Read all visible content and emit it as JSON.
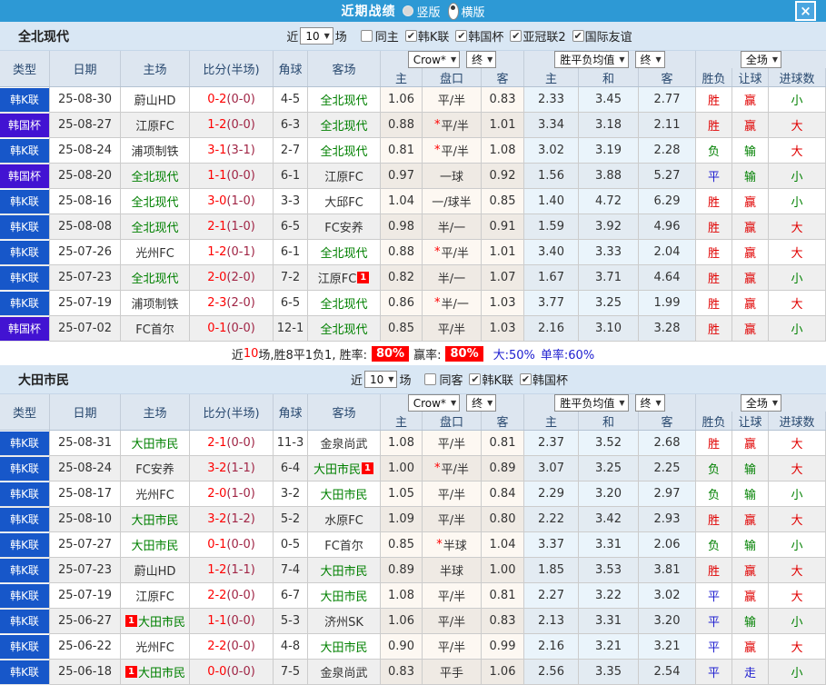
{
  "topbar": {
    "title": "近期战绩",
    "radios": [
      {
        "label": "竖版",
        "selected": false
      },
      {
        "label": "横版",
        "selected": true
      }
    ],
    "close": "×"
  },
  "filter_bar": {
    "near": "近",
    "count": "10",
    "games": "场"
  },
  "header": {
    "cols": {
      "type": "类型",
      "date": "日期",
      "home": "主场",
      "score": "比分(半场)",
      "corner": "角球",
      "away": "客场",
      "h": "主",
      "pan": "盘口",
      "a": "客",
      "avg_h": "主",
      "avg_d": "和",
      "avg_a": "客",
      "wl": "胜负",
      "hcp": "让球",
      "goals": "进球数"
    },
    "selects": {
      "bookmaker": "Crow*",
      "final1": "终",
      "avg": "胜平负均值",
      "final2": "终",
      "scope": "全场"
    }
  },
  "sections": [
    {
      "team": "全北现代",
      "filters": [
        {
          "label": "同主",
          "checked": false
        },
        {
          "label": "韩K联",
          "checked": true
        },
        {
          "label": "韩国杯",
          "checked": true
        },
        {
          "label": "亚冠联2",
          "checked": true
        },
        {
          "label": "国际友谊",
          "checked": true
        }
      ],
      "rows": [
        {
          "t": "韩K联",
          "tc": "lg",
          "d": "25-08-30",
          "h": "蔚山HD",
          "hg": 0,
          "hb": "",
          "hpre": false,
          "sf": "0-2",
          "sh": "(0-0)",
          "c": "4-5",
          "a": "全北现代",
          "ag": 1,
          "ab": "",
          "apre": false,
          "o1": "1.06",
          "ps": 0,
          "p": "平/半",
          "o2": "0.83",
          "m1": "2.33",
          "m2": "3.45",
          "m3": "2.77",
          "r1": "胜",
          "k1": "r",
          "r2": "赢",
          "k2": "r",
          "r3": "小",
          "k3": "g"
        },
        {
          "t": "韩国杯",
          "tc": "cup",
          "d": "25-08-27",
          "h": "江原FC",
          "hg": 0,
          "hb": "",
          "hpre": false,
          "sf": "1-2",
          "sh": "(0-0)",
          "c": "6-3",
          "a": "全北现代",
          "ag": 1,
          "ab": "",
          "apre": false,
          "o1": "0.88",
          "ps": 1,
          "p": "平/半",
          "o2": "1.01",
          "m1": "3.34",
          "m2": "3.18",
          "m3": "2.11",
          "r1": "胜",
          "k1": "r",
          "r2": "赢",
          "k2": "r",
          "r3": "大",
          "k3": "r"
        },
        {
          "t": "韩K联",
          "tc": "lg",
          "d": "25-08-24",
          "h": "浦项制铁",
          "hg": 0,
          "hb": "",
          "hpre": false,
          "sf": "3-1",
          "sh": "(3-1)",
          "c": "2-7",
          "a": "全北现代",
          "ag": 1,
          "ab": "",
          "apre": false,
          "o1": "0.81",
          "ps": 1,
          "p": "平/半",
          "o2": "1.08",
          "m1": "3.02",
          "m2": "3.19",
          "m3": "2.28",
          "r1": "负",
          "k1": "g",
          "r2": "输",
          "k2": "g",
          "r3": "大",
          "k3": "r"
        },
        {
          "t": "韩国杯",
          "tc": "cup",
          "d": "25-08-20",
          "h": "全北现代",
          "hg": 1,
          "hb": "",
          "hpre": false,
          "sf": "1-1",
          "sh": "(0-0)",
          "c": "6-1",
          "a": "江原FC",
          "ag": 0,
          "ab": "",
          "apre": false,
          "o1": "0.97",
          "ps": 0,
          "p": "一球",
          "o2": "0.92",
          "m1": "1.56",
          "m2": "3.88",
          "m3": "5.27",
          "r1": "平",
          "k1": "b",
          "r2": "输",
          "k2": "g",
          "r3": "小",
          "k3": "g"
        },
        {
          "t": "韩K联",
          "tc": "lg",
          "d": "25-08-16",
          "h": "全北现代",
          "hg": 1,
          "hb": "",
          "hpre": false,
          "sf": "3-0",
          "sh": "(1-0)",
          "c": "3-3",
          "a": "大邱FC",
          "ag": 0,
          "ab": "",
          "apre": false,
          "o1": "1.04",
          "ps": 0,
          "p": "一/球半",
          "o2": "0.85",
          "m1": "1.40",
          "m2": "4.72",
          "m3": "6.29",
          "r1": "胜",
          "k1": "r",
          "r2": "赢",
          "k2": "r",
          "r3": "小",
          "k3": "g"
        },
        {
          "t": "韩K联",
          "tc": "lg",
          "d": "25-08-08",
          "h": "全北现代",
          "hg": 1,
          "hb": "",
          "hpre": false,
          "sf": "2-1",
          "sh": "(1-0)",
          "c": "6-5",
          "a": "FC安养",
          "ag": 0,
          "ab": "",
          "apre": false,
          "o1": "0.98",
          "ps": 0,
          "p": "半/一",
          "o2": "0.91",
          "m1": "1.59",
          "m2": "3.92",
          "m3": "4.96",
          "r1": "胜",
          "k1": "r",
          "r2": "赢",
          "k2": "r",
          "r3": "大",
          "k3": "r"
        },
        {
          "t": "韩K联",
          "tc": "lg",
          "d": "25-07-26",
          "h": "光州FC",
          "hg": 0,
          "hb": "",
          "hpre": false,
          "sf": "1-2",
          "sh": "(0-1)",
          "c": "6-1",
          "a": "全北现代",
          "ag": 1,
          "ab": "",
          "apre": false,
          "o1": "0.88",
          "ps": 1,
          "p": "平/半",
          "o2": "1.01",
          "m1": "3.40",
          "m2": "3.33",
          "m3": "2.04",
          "r1": "胜",
          "k1": "r",
          "r2": "赢",
          "k2": "r",
          "r3": "大",
          "k3": "r"
        },
        {
          "t": "韩K联",
          "tc": "lg",
          "d": "25-07-23",
          "h": "全北现代",
          "hg": 1,
          "hb": "",
          "hpre": false,
          "sf": "2-0",
          "sh": "(2-0)",
          "c": "7-2",
          "a": "江原FC",
          "ag": 0,
          "ab": "1",
          "apre": false,
          "o1": "0.82",
          "ps": 0,
          "p": "半/一",
          "o2": "1.07",
          "m1": "1.67",
          "m2": "3.71",
          "m3": "4.64",
          "r1": "胜",
          "k1": "r",
          "r2": "赢",
          "k2": "r",
          "r3": "小",
          "k3": "g"
        },
        {
          "t": "韩K联",
          "tc": "lg",
          "d": "25-07-19",
          "h": "浦项制铁",
          "hg": 0,
          "hb": "",
          "hpre": false,
          "sf": "2-3",
          "sh": "(2-0)",
          "c": "6-5",
          "a": "全北现代",
          "ag": 1,
          "ab": "",
          "apre": false,
          "o1": "0.86",
          "ps": 1,
          "p": "半/一",
          "o2": "1.03",
          "m1": "3.77",
          "m2": "3.25",
          "m3": "1.99",
          "r1": "胜",
          "k1": "r",
          "r2": "赢",
          "k2": "r",
          "r3": "大",
          "k3": "r"
        },
        {
          "t": "韩国杯",
          "tc": "cup",
          "d": "25-07-02",
          "h": "FC首尔",
          "hg": 0,
          "hb": "",
          "hpre": false,
          "sf": "0-1",
          "sh": "(0-0)",
          "c": "12-1",
          "a": "全北现代",
          "ag": 1,
          "ab": "",
          "apre": false,
          "o1": "0.85",
          "ps": 0,
          "p": "平/半",
          "o2": "1.03",
          "m1": "2.16",
          "m2": "3.10",
          "m3": "3.28",
          "r1": "胜",
          "k1": "r",
          "r2": "赢",
          "k2": "r",
          "r3": "小",
          "k3": "g"
        }
      ],
      "summary": {
        "prefix": "近",
        "count": "10",
        "mid": "场,胜8平1负1, 胜率:",
        "rate1": "80%",
        "label2": "赢率:",
        "rate2": "80%",
        "big": "大:50%",
        "single": "单率:60%"
      }
    },
    {
      "team": "大田市民",
      "filters": [
        {
          "label": "同客",
          "checked": false
        },
        {
          "label": "韩K联",
          "checked": true
        },
        {
          "label": "韩国杯",
          "checked": true
        }
      ],
      "rows": [
        {
          "t": "韩K联",
          "tc": "lg",
          "d": "25-08-31",
          "h": "大田市民",
          "hg": 1,
          "hb": "",
          "hpre": false,
          "sf": "2-1",
          "sh": "(0-0)",
          "c": "11-3",
          "a": "金泉尚武",
          "ag": 0,
          "ab": "",
          "apre": false,
          "o1": "1.08",
          "ps": 0,
          "p": "平/半",
          "o2": "0.81",
          "m1": "2.37",
          "m2": "3.52",
          "m3": "2.68",
          "r1": "胜",
          "k1": "r",
          "r2": "赢",
          "k2": "r",
          "r3": "大",
          "k3": "r"
        },
        {
          "t": "韩K联",
          "tc": "lg",
          "d": "25-08-24",
          "h": "FC安养",
          "hg": 0,
          "hb": "",
          "hpre": false,
          "sf": "3-2",
          "sh": "(1-1)",
          "c": "6-4",
          "a": "大田市民",
          "ag": 1,
          "ab": "1",
          "apre": false,
          "o1": "1.00",
          "ps": 1,
          "p": "平/半",
          "o2": "0.89",
          "m1": "3.07",
          "m2": "3.25",
          "m3": "2.25",
          "r1": "负",
          "k1": "g",
          "r2": "输",
          "k2": "g",
          "r3": "大",
          "k3": "r"
        },
        {
          "t": "韩K联",
          "tc": "lg",
          "d": "25-08-17",
          "h": "光州FC",
          "hg": 0,
          "hb": "",
          "hpre": false,
          "sf": "2-0",
          "sh": "(1-0)",
          "c": "3-2",
          "a": "大田市民",
          "ag": 1,
          "ab": "",
          "apre": false,
          "o1": "1.05",
          "ps": 0,
          "p": "平/半",
          "o2": "0.84",
          "m1": "2.29",
          "m2": "3.20",
          "m3": "2.97",
          "r1": "负",
          "k1": "g",
          "r2": "输",
          "k2": "g",
          "r3": "小",
          "k3": "g"
        },
        {
          "t": "韩K联",
          "tc": "lg",
          "d": "25-08-10",
          "h": "大田市民",
          "hg": 1,
          "hb": "",
          "hpre": false,
          "sf": "3-2",
          "sh": "(1-2)",
          "c": "5-2",
          "a": "水原FC",
          "ag": 0,
          "ab": "",
          "apre": false,
          "o1": "1.09",
          "ps": 0,
          "p": "平/半",
          "o2": "0.80",
          "m1": "2.22",
          "m2": "3.42",
          "m3": "2.93",
          "r1": "胜",
          "k1": "r",
          "r2": "赢",
          "k2": "r",
          "r3": "大",
          "k3": "r"
        },
        {
          "t": "韩K联",
          "tc": "lg",
          "d": "25-07-27",
          "h": "大田市民",
          "hg": 1,
          "hb": "",
          "hpre": false,
          "sf": "0-1",
          "sh": "(0-0)",
          "c": "0-5",
          "a": "FC首尔",
          "ag": 0,
          "ab": "",
          "apre": false,
          "o1": "0.85",
          "ps": 1,
          "p": "半球",
          "o2": "1.04",
          "m1": "3.37",
          "m2": "3.31",
          "m3": "2.06",
          "r1": "负",
          "k1": "g",
          "r2": "输",
          "k2": "g",
          "r3": "小",
          "k3": "g"
        },
        {
          "t": "韩K联",
          "tc": "lg",
          "d": "25-07-23",
          "h": "蔚山HD",
          "hg": 0,
          "hb": "",
          "hpre": false,
          "sf": "1-2",
          "sh": "(1-1)",
          "c": "7-4",
          "a": "大田市民",
          "ag": 1,
          "ab": "",
          "apre": false,
          "o1": "0.89",
          "ps": 0,
          "p": "半球",
          "o2": "1.00",
          "m1": "1.85",
          "m2": "3.53",
          "m3": "3.81",
          "r1": "胜",
          "k1": "r",
          "r2": "赢",
          "k2": "r",
          "r3": "大",
          "k3": "r"
        },
        {
          "t": "韩K联",
          "tc": "lg",
          "d": "25-07-19",
          "h": "江原FC",
          "hg": 0,
          "hb": "",
          "hpre": false,
          "sf": "2-2",
          "sh": "(0-0)",
          "c": "6-7",
          "a": "大田市民",
          "ag": 1,
          "ab": "",
          "apre": false,
          "o1": "1.08",
          "ps": 0,
          "p": "平/半",
          "o2": "0.81",
          "m1": "2.27",
          "m2": "3.22",
          "m3": "3.02",
          "r1": "平",
          "k1": "b",
          "r2": "赢",
          "k2": "r",
          "r3": "大",
          "k3": "r"
        },
        {
          "t": "韩K联",
          "tc": "lg",
          "d": "25-06-27",
          "h": "大田市民",
          "hg": 1,
          "hb": "1",
          "hpre": true,
          "sf": "1-1",
          "sh": "(0-0)",
          "c": "5-3",
          "a": "济州SK",
          "ag": 0,
          "ab": "",
          "apre": false,
          "o1": "1.06",
          "ps": 0,
          "p": "平/半",
          "o2": "0.83",
          "m1": "2.13",
          "m2": "3.31",
          "m3": "3.20",
          "r1": "平",
          "k1": "b",
          "r2": "输",
          "k2": "g",
          "r3": "小",
          "k3": "g"
        },
        {
          "t": "韩K联",
          "tc": "lg",
          "d": "25-06-22",
          "h": "光州FC",
          "hg": 0,
          "hb": "",
          "hpre": false,
          "sf": "2-2",
          "sh": "(0-0)",
          "c": "4-8",
          "a": "大田市民",
          "ag": 1,
          "ab": "",
          "apre": false,
          "o1": "0.90",
          "ps": 0,
          "p": "平/半",
          "o2": "0.99",
          "m1": "2.16",
          "m2": "3.21",
          "m3": "3.21",
          "r1": "平",
          "k1": "b",
          "r2": "赢",
          "k2": "r",
          "r3": "大",
          "k3": "r"
        },
        {
          "t": "韩K联",
          "tc": "lg",
          "d": "25-06-18",
          "h": "大田市民",
          "hg": 1,
          "hb": "1",
          "hpre": true,
          "sf": "0-0",
          "sh": "(0-0)",
          "c": "7-5",
          "a": "金泉尚武",
          "ag": 0,
          "ab": "",
          "apre": false,
          "o1": "0.83",
          "ps": 0,
          "p": "平手",
          "o2": "1.06",
          "m1": "2.56",
          "m2": "3.35",
          "m3": "2.54",
          "r1": "平",
          "k1": "b",
          "r2": "走",
          "k2": "b",
          "r3": "小",
          "k3": "g"
        }
      ]
    }
  ]
}
